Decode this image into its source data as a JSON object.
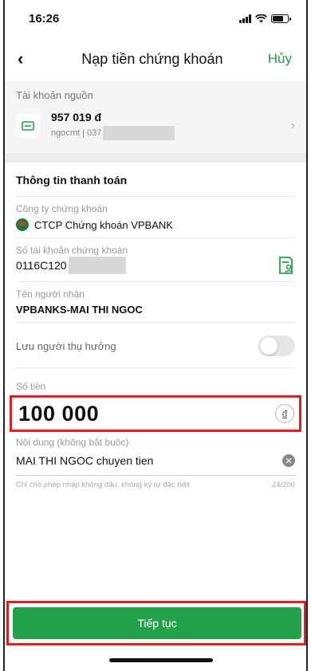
{
  "status_bar": {
    "time": "16:26"
  },
  "nav": {
    "back_icon": "‹",
    "title": "Nạp tiền chứng khoán",
    "cancel_label": "Hủy"
  },
  "source": {
    "label": "Tài khoản nguồn",
    "balance": "957 019  đ",
    "sub": "ngocmt | 037"
  },
  "payment": {
    "header": "Thông tin thanh toán",
    "company_label": "Công ty chứng khoán",
    "company_value": "CTCP Chứng khoán VPBANK",
    "account_label": "Số tài khoản chứng khoán",
    "account_value": "0116C120",
    "recipient_label": "Tên người nhận",
    "recipient_value": "VPBANKS-MAI THI NGOC",
    "save_label": "Lưu người thụ hưởng",
    "save_enabled": false,
    "amount_label": "Số tiền",
    "amount_value": "100 000",
    "currency_symbol": "đ",
    "note_label": "Nội dung (không bắt buộc)",
    "note_value": "MAI THI NGOC chuyen tien",
    "note_hint": "Chỉ cho phép nhập không dấu, không ký tự đặc biệt",
    "note_counter": "24/200"
  },
  "footer": {
    "continue_label": "Tiếp tục"
  },
  "colors": {
    "accent": "#22a24a",
    "highlight": "#e02020"
  }
}
